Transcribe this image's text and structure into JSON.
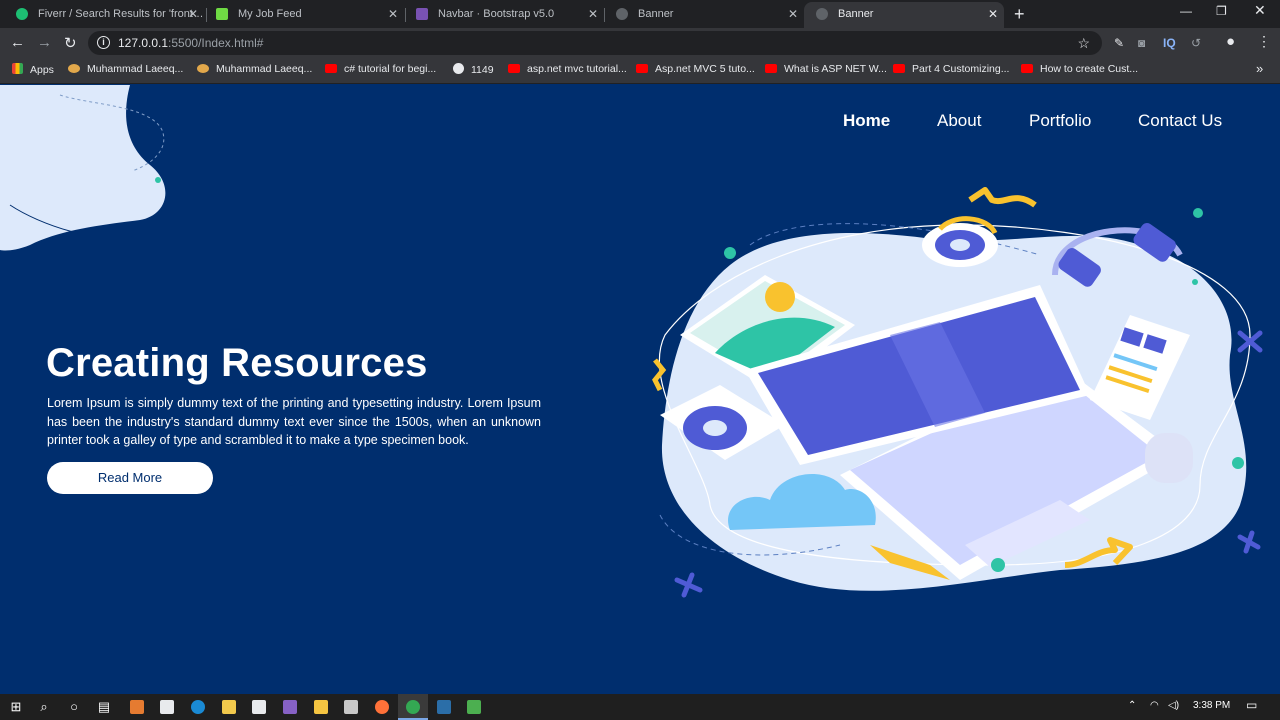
{
  "browser": {
    "tabs": [
      {
        "title": "Fiverr / Search Results for 'front …",
        "icon_color": "#1dbf73"
      },
      {
        "title": "My Job Feed",
        "icon_color": "#6fda44"
      },
      {
        "title": "Navbar · Bootstrap v5.0",
        "icon_color": "#7952b3"
      },
      {
        "title": "Banner",
        "icon_color": "#5f6368"
      },
      {
        "title": "Banner",
        "icon_color": "#5f6368"
      }
    ],
    "new_tab_label": "+",
    "url_host": "127.0.0.1",
    "url_path": ":5500/Index.html#",
    "bookmarks": [
      {
        "label": "Apps",
        "icon": "apps-grid-icon"
      },
      {
        "label": "Muhammad Laeeq...",
        "icon": "bookmark-favicon-icon"
      },
      {
        "label": "Muhammad Laeeq...",
        "icon": "bookmark-favicon-icon"
      },
      {
        "label": "c# tutorial for begi...",
        "icon": "youtube-icon"
      },
      {
        "label": "1149",
        "icon": "globe-icon"
      },
      {
        "label": "asp.net mvc tutorial...",
        "icon": "youtube-icon"
      },
      {
        "label": "Asp.net MVC 5 tuto...",
        "icon": "youtube-icon"
      },
      {
        "label": "What is ASP NET W...",
        "icon": "youtube-icon"
      },
      {
        "label": "Part 4 Customizing...",
        "icon": "youtube-icon"
      },
      {
        "label": "How to create Cust...",
        "icon": "youtube-icon"
      }
    ],
    "bookmarks_overflow": "»"
  },
  "page": {
    "nav": {
      "home": "Home",
      "about": "About",
      "portfolio": "Portfolio",
      "contact": "Contact Us"
    },
    "hero": {
      "title": "Creating Resources",
      "text": "Lorem Ipsum is simply dummy text of the printing and typesetting industry. Lorem Ipsum has been the industry's standard dummy text ever since the 1500s, when an unknown printer took a galley of type and scrambled it to make a type specimen book.",
      "button": "Read More"
    },
    "colors": {
      "background": "#002e6e",
      "accent_blue": "#4f5bd5",
      "accent_yellow": "#f9c22e",
      "accent_teal": "#2ec4a6",
      "blob_light": "#dde9fb"
    }
  },
  "taskbar": {
    "time": "3:38 PM"
  }
}
